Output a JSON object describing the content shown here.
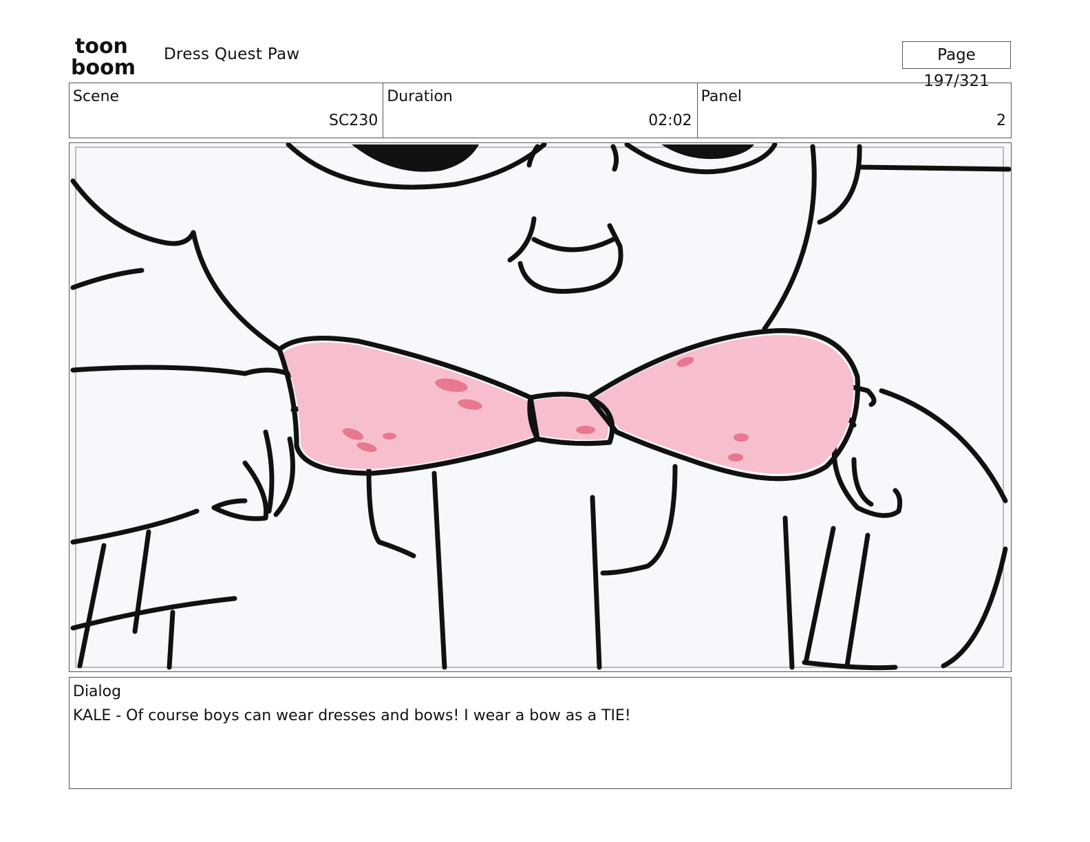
{
  "header": {
    "logo_text_top": "toon",
    "logo_text_bottom": "boom",
    "project_title": "Dress Quest Paw",
    "page_indicator": "Page 197/321"
  },
  "info": {
    "scene_label": "Scene",
    "scene_value": "SC230",
    "duration_label": "Duration",
    "duration_value": "02:02",
    "panel_label": "Panel",
    "panel_value": "2"
  },
  "artwork": {
    "subject": "bow-tie-held-by-paws",
    "bow_color": "#f7bfcd",
    "bow_spot_color": "#e7788f",
    "line_color": "#111111",
    "background_color": "#f7f8fc"
  },
  "dialog": {
    "label": "Dialog",
    "text": "KALE - Of course boys can wear dresses and bows! I wear a bow as a TIE!"
  }
}
